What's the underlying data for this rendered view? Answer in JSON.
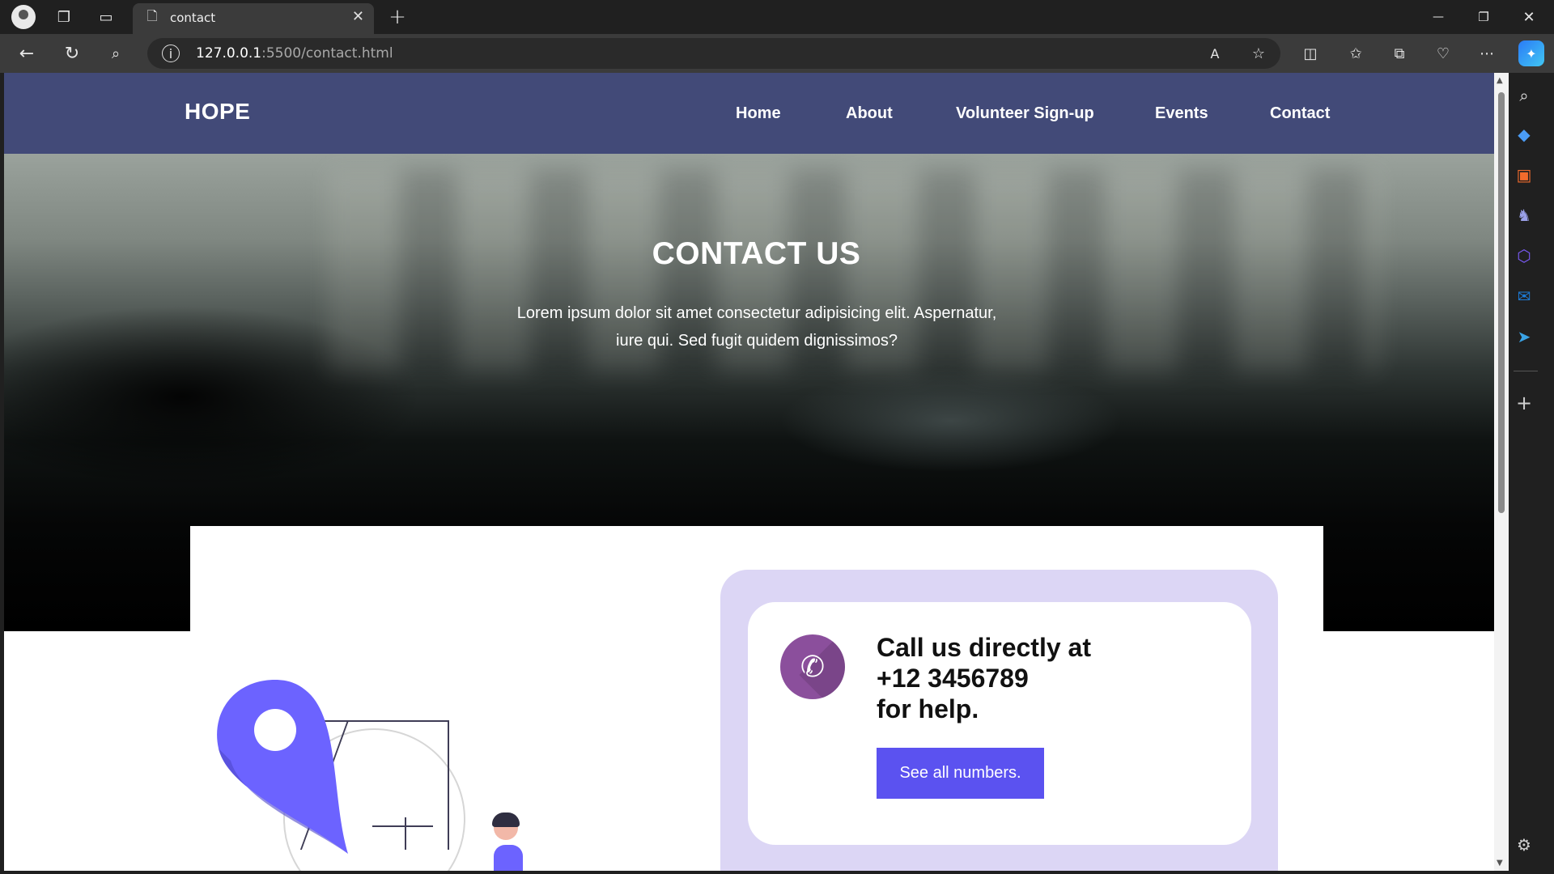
{
  "browser": {
    "tab_title": "contact",
    "tab_close": "✕",
    "new_tab": "+",
    "url_host": "127.0.0.1",
    "url_path": ":5500/contact.html",
    "window_min": "—",
    "window_restore": "❐",
    "window_close": "✕"
  },
  "navbar": {
    "brand": "HOPE",
    "links": [
      "Home",
      "About",
      "Volunteer Sign-up",
      "Events",
      "Contact"
    ]
  },
  "hero": {
    "title": "CONTACT US",
    "text_line1": "Lorem ipsum dolor sit amet consectetur adipisicing elit. Aspernatur,",
    "text_line2": "iure qui. Sed fugit quidem dignissimos?"
  },
  "call": {
    "line1": "Call us directly at",
    "line2": "+12 3456789",
    "line3": "for help.",
    "button": "See all numbers."
  },
  "colors": {
    "navbar": "#424a78",
    "accent": "#5b52f0",
    "call_bg": "#dcd6f5",
    "phone_circle": "#8b4f9c"
  }
}
